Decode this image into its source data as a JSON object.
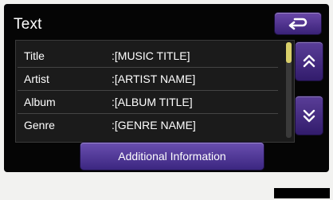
{
  "screen": {
    "title": "Text",
    "back_icon": "return-arrow-icon"
  },
  "details": {
    "rows": [
      {
        "label": "Title",
        "value": ":[MUSIC TITLE]"
      },
      {
        "label": "Artist",
        "value": ":[ARTIST NAME]"
      },
      {
        "label": "Album",
        "value": ":[ALBUM TITLE]"
      },
      {
        "label": "Genre",
        "value": ":[GENRE NAME]"
      }
    ],
    "scroll_up_icon": "double-chevron-up-icon",
    "scroll_down_icon": "double-chevron-down-icon"
  },
  "footer": {
    "button_label": "Additional Information"
  },
  "colors": {
    "accent": "#4a2f90",
    "scroll_thumb": "#d8cf6a",
    "background": "#050505"
  }
}
